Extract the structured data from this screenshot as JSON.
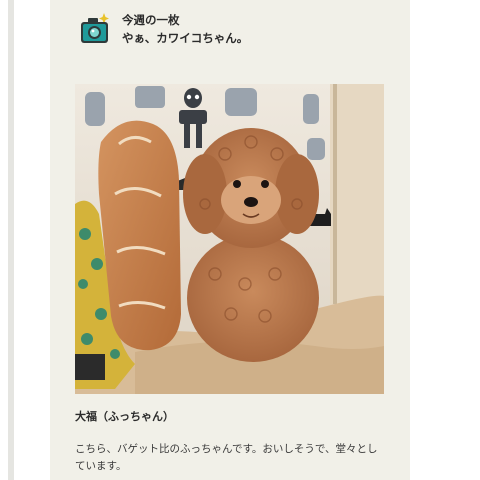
{
  "header": {
    "title": "今週の一枚",
    "subtitle": "やぁ、カワイコちゃん。"
  },
  "photo": {
    "icon": "camera-icon"
  },
  "caption": {
    "title": "大福（ふっちゃん）",
    "body": "こちら、バゲット比のふっちゃんです。おいしそうで、堂々としています。"
  },
  "colors": {
    "card_background": "#f1f0e8",
    "icon_teal": "#1f9a9a",
    "icon_dark": "#2f3a3a",
    "accent_yellow": "#e8c22a"
  }
}
